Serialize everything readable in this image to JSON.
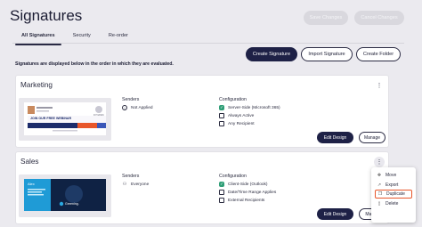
{
  "header": {
    "title": "Signatures",
    "save_label": "Save Changes",
    "cancel_label": "Cancel Changes"
  },
  "tabs": [
    {
      "label": "All Signatures",
      "active": true
    },
    {
      "label": "Security",
      "active": false
    },
    {
      "label": "Re-order",
      "active": false
    }
  ],
  "actions": {
    "create_signature": "Create Signature",
    "import_signature": "Import Signature",
    "create_folder": "Create Folder"
  },
  "info_text": "Signatures are displayed below in the order in which they are evaluated.",
  "cards": [
    {
      "name": "Marketing",
      "senders_label": "Senders",
      "senders_value": "Not Applied",
      "config_label": "Configuration",
      "config_items": [
        "Server-Side (Microsoft 365)",
        "Always Active",
        "Any Recipient"
      ],
      "edit_label": "Edit Design",
      "manage_label": "Manage",
      "preview": {
        "banner_text": "JOIN OUR FREE WEBINAR",
        "logo_text": "DYNAMIC"
      }
    },
    {
      "name": "Sales",
      "senders_label": "Senders",
      "senders_value": "Everyone",
      "config_label": "Configuration",
      "config_items": [
        "Client-Side (Outlook)",
        "Date/Time Range Applies",
        "External Recipients"
      ],
      "edit_label": "Edit Design",
      "manage_label": "Manag",
      "preview": {
        "name_text": "Alex",
        "brand_text": "Greening."
      }
    }
  ],
  "context_menu": {
    "items": [
      "Move",
      "Export",
      "Duplicate",
      "Delete"
    ]
  },
  "menu_glyph": "⋮",
  "colors": {
    "background": "#ebeaef",
    "primary": "#1e2146",
    "highlight": "#e8572b",
    "success": "#2f9e76"
  }
}
